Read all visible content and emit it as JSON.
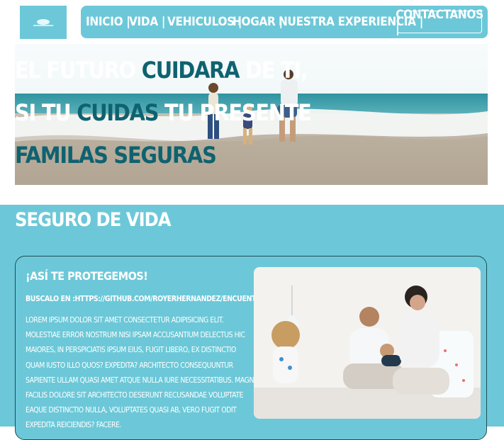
{
  "nav": {
    "items": [
      {
        "label": "INICIO |"
      },
      {
        "label": "VIDA |"
      },
      {
        "label": "VEHICULOS |"
      },
      {
        "label": "HOGAR |"
      },
      {
        "label": "NUESTRA EXPERIENCIA |"
      }
    ],
    "contact_label": "CONTACTANOS |"
  },
  "hero": {
    "line1_a": "EL FUTURO ",
    "line1_b": "CUIDARA",
    "line1_c": " DE TI,",
    "line2_a": "SI TU ",
    "line2_b": "CUIDAS",
    "line2_c": " TU PRESENTE",
    "line3": "FAMILAS SEGURAS"
  },
  "section": {
    "title": "SEGURO DE VIDA",
    "card": {
      "heading": "¡ASÍ TE PROTEGEMOS!",
      "search": "BUSCALO EN :HTTPS://GITHUB.COM/ROYERHERNANDEZ/ENCUENTRALO",
      "body": "LOREM IPSUM DOLOR SIT AMET CONSECTETUR ADIPISICING ELIT. MOLESTIAE ERROR NOSTRUM NISI IPSAM ACCUSANTIUM DELECTUS HIC MAIORES, IN PERSPICIATIS IPSUM EIUS, FUGIT LIBERO, EX DISTINCTIO QUAM IUSTO ILLO QUOS? EXPEDITA? ARCHITECTO CONSEQUUNTUR SAPIENTE ULLAM QUASI AMET ATQUE NULLA IURE NECESSITATIBUS. MAGNI FACILIS DOLORE SIT ARCHITECTO DESERUNT RECUSANDAE VOLUPTATE EAQUE DISTINCTIO NULLA, VOLUPTATES QUASI AB, VERO FUGIT ODIT EXPEDITA REICIENDIS? FACERE."
    }
  },
  "colors": {
    "accent": "#6cc8d8",
    "teal_dark": "#0f6270",
    "text_light": "#ffffff"
  }
}
